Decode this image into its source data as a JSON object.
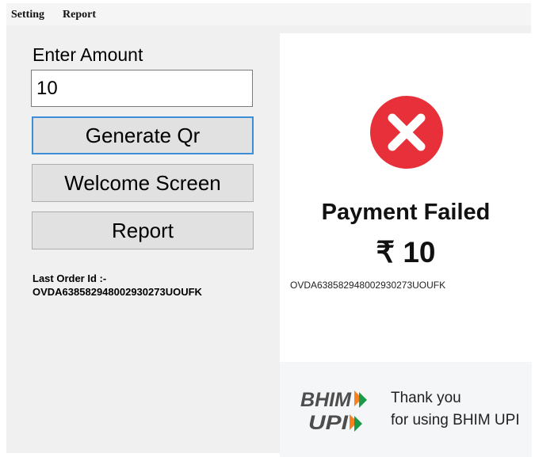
{
  "menu": {
    "items": [
      "Setting",
      "Report"
    ]
  },
  "form": {
    "amount_label": "Enter Amount",
    "amount_value": "10",
    "buttons": {
      "generate": "Generate Qr",
      "welcome": "Welcome Screen",
      "report": "Report"
    },
    "last_order_label": "Last Order Id :-",
    "last_order_id": "OVDA638582948002930273UOUFK"
  },
  "panel": {
    "status": "Payment Failed",
    "amount": "₹ 10",
    "order_id": "OVDA638582948002930273UOUFK",
    "logo": {
      "line1": "BHIM",
      "line2": "UPI"
    },
    "thanks_line1": "Thank you",
    "thanks_line2": "for using BHIM UPI",
    "colors": {
      "fail_red": "#e8303a",
      "upi_orange": "#f5821f",
      "upi_green": "#1a9a48",
      "upi_text": "#4d4d4d"
    },
    "icon": "close-circle-icon"
  }
}
